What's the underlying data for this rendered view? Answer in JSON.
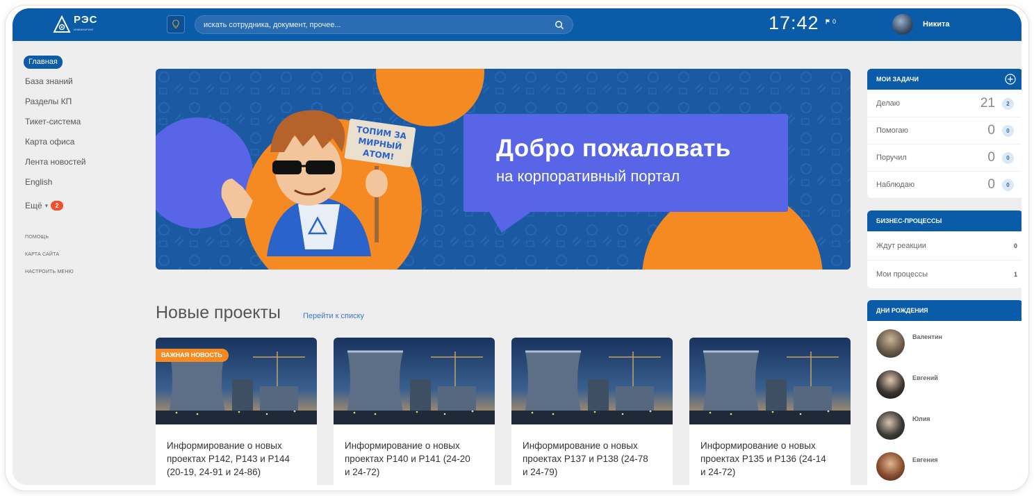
{
  "header": {
    "logo_text": "РЭС",
    "logo_subtext": "ИНЖИНИРИНГ",
    "search_placeholder": "искать сотрудника, документ, прочее...",
    "time": "17:42",
    "flag_count": "0",
    "user_name": "Никита"
  },
  "nav": {
    "items": [
      {
        "label": "Главная",
        "active": true
      },
      {
        "label": "База знаний"
      },
      {
        "label": "Разделы КП"
      },
      {
        "label": "Тикет-система"
      },
      {
        "label": "Карта офиса"
      },
      {
        "label": "Лента новостей"
      },
      {
        "label": "English"
      }
    ],
    "more_label": "Ещё",
    "more_badge": "2",
    "secondary": [
      "ПОМОЩЬ",
      "КАРТА САЙТА",
      "НАСТРОИТЬ МЕНЮ"
    ]
  },
  "banner": {
    "title": "Добро пожаловать",
    "subtitle": "на корпоративный портал",
    "sign_lines": [
      "ТОПИМ ЗА",
      "МИРНЫЙ",
      "АТОМ!"
    ]
  },
  "projects": {
    "title": "Новые проекты",
    "link": "Перейти к списку",
    "important_tag": "ВАЖНАЯ НОВОСТЬ",
    "cards": [
      {
        "lines": [
          "Информирование о новых",
          "проектах Р142, Р143 и Р144",
          "(20-19, 24-91 и 24-86)"
        ],
        "important": true
      },
      {
        "lines": [
          "Информирование о новых",
          "проектах Р140 и Р141 (24-20",
          "и 24-72)"
        ]
      },
      {
        "lines": [
          "Информирование о новых",
          "проектах Р137 и Р138 (24-78",
          "и 24-79)"
        ]
      },
      {
        "lines": [
          "Информирование о новых",
          "проектах Р135 и Р136 (24-14",
          "и 24-72)"
        ]
      }
    ]
  },
  "tasks": {
    "title": "МОИ ЗАДАЧИ",
    "rows": [
      {
        "label": "Делаю",
        "count": "21",
        "badge": "2"
      },
      {
        "label": "Помогаю",
        "count": "0",
        "badge": "0"
      },
      {
        "label": "Поручил",
        "count": "0",
        "badge": "0"
      },
      {
        "label": "Наблюдаю",
        "count": "0",
        "badge": "0"
      }
    ]
  },
  "processes": {
    "title": "БИЗНЕС-ПРОЦЕССЫ",
    "rows": [
      {
        "label": "Ждут реакции",
        "count": "0"
      },
      {
        "label": "Мои процессы",
        "count": "1"
      }
    ]
  },
  "birthdays": {
    "title": "ДНИ РОЖДЕНИЯ",
    "people": [
      "Валентин",
      "Евгений",
      "Юлия",
      "Евгения"
    ]
  },
  "colors": {
    "brand_blue": "#0a5ba8",
    "banner_blue": "#1b5aa3",
    "accent_orange": "#f58a22",
    "speech_violet": "#5865e6",
    "badge_red": "#f0502a"
  }
}
